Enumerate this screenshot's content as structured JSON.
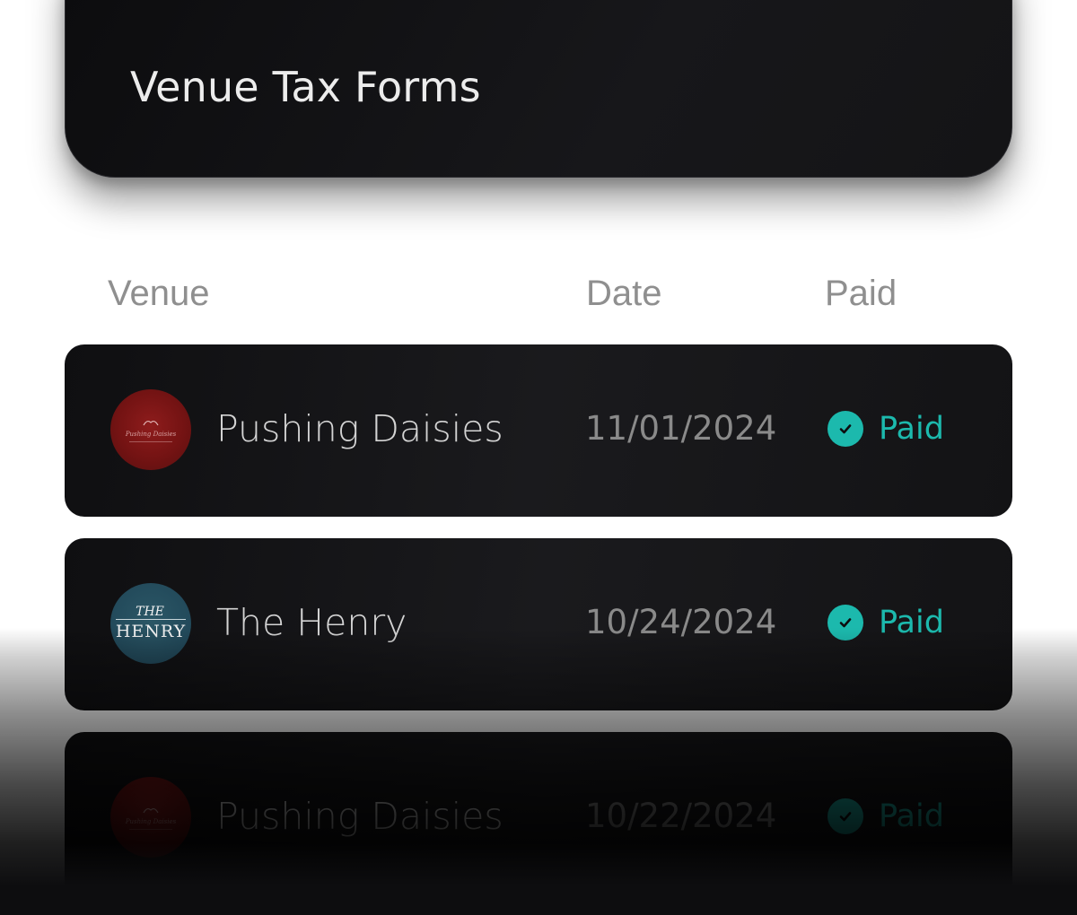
{
  "header": {
    "title": "Venue Tax Forms"
  },
  "table": {
    "columns": [
      "Venue",
      "Date",
      "Paid"
    ],
    "rows": [
      {
        "venue": "Pushing Daisies",
        "logo_text": "Pushing Daisies",
        "date": "11/01/2024",
        "status": "Paid",
        "status_icon": "check-circle-icon"
      },
      {
        "venue": "The Henry",
        "logo_text_top": "THE",
        "logo_text_bottom": "HENRY",
        "date": "10/24/2024",
        "status": "Paid",
        "status_icon": "check-circle-icon"
      },
      {
        "venue": "Pushing Daisies",
        "logo_text": "Pushing Daisies",
        "date": "10/22/2024",
        "status": "Paid",
        "status_icon": "check-circle-icon"
      }
    ]
  },
  "colors": {
    "accent": "#1cb9ad",
    "card_bg": "#141416",
    "page_bg": "#ffffff"
  }
}
